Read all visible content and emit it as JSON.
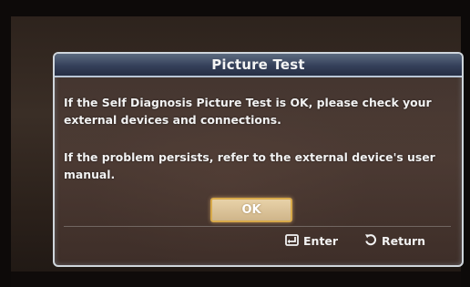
{
  "dialog": {
    "title": "Picture Test",
    "message_1": "If the Self Diagnosis Picture Test is OK, please check your external devices and connections.",
    "message_2": "If the problem persists, refer to the external device's user manual.",
    "ok_label": "OK"
  },
  "footer": {
    "enter_label": "Enter",
    "enter_icon": "enter-icon",
    "return_label": "Return",
    "return_icon": "return-icon"
  },
  "colors": {
    "title_bar": "#35405a",
    "dialog_border": "#cfd6dc",
    "ok_highlight": "#d7a94a"
  }
}
